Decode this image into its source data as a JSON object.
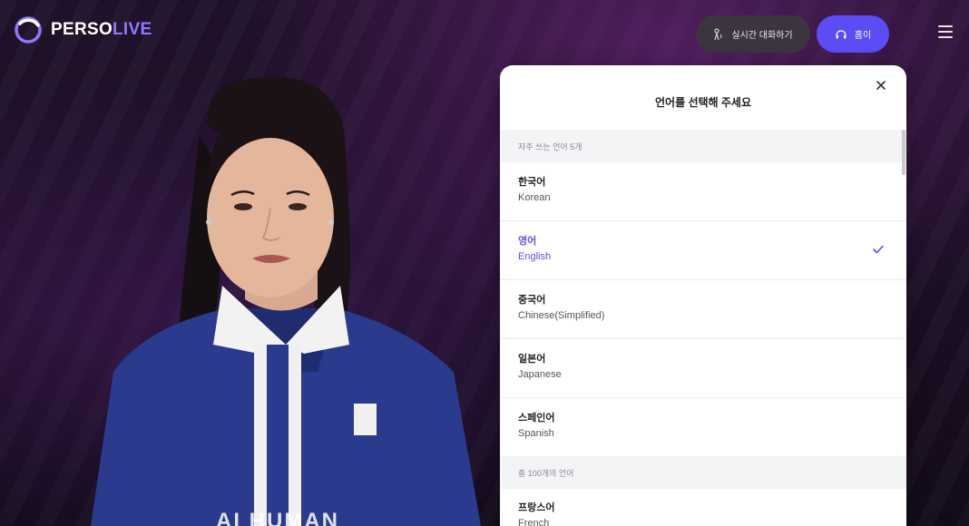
{
  "brand": {
    "name_part1": "PERSO",
    "name_part2": "LIVE",
    "accent": "#8c7bff"
  },
  "header": {
    "live_chat_button": "실시간 대화하기",
    "live_chat_icon": "talk-icon",
    "home_button": "홈이",
    "home_icon": "headset-icon",
    "menu_icon": "hamburger-menu-icon"
  },
  "avatar": {
    "caption": "AI HUMAN"
  },
  "modal": {
    "title": "언어를 선택해 주세요",
    "frequent_header": "자주 쓰는 언어 5개",
    "all_header": "총 100개의 언어",
    "selected_color": "#5b4cf5",
    "languages": [
      {
        "native": "한국어",
        "english": "Korean",
        "selected": false
      },
      {
        "native": "영어",
        "english": "English",
        "selected": true
      },
      {
        "native": "중국어",
        "english": "Chinese(Simplified)",
        "selected": false
      },
      {
        "native": "일본어",
        "english": "Japanese",
        "selected": false
      },
      {
        "native": "스페인어",
        "english": "Spanish",
        "selected": false
      }
    ],
    "more_languages": [
      {
        "native": "프랑스어",
        "english": "French"
      }
    ]
  }
}
